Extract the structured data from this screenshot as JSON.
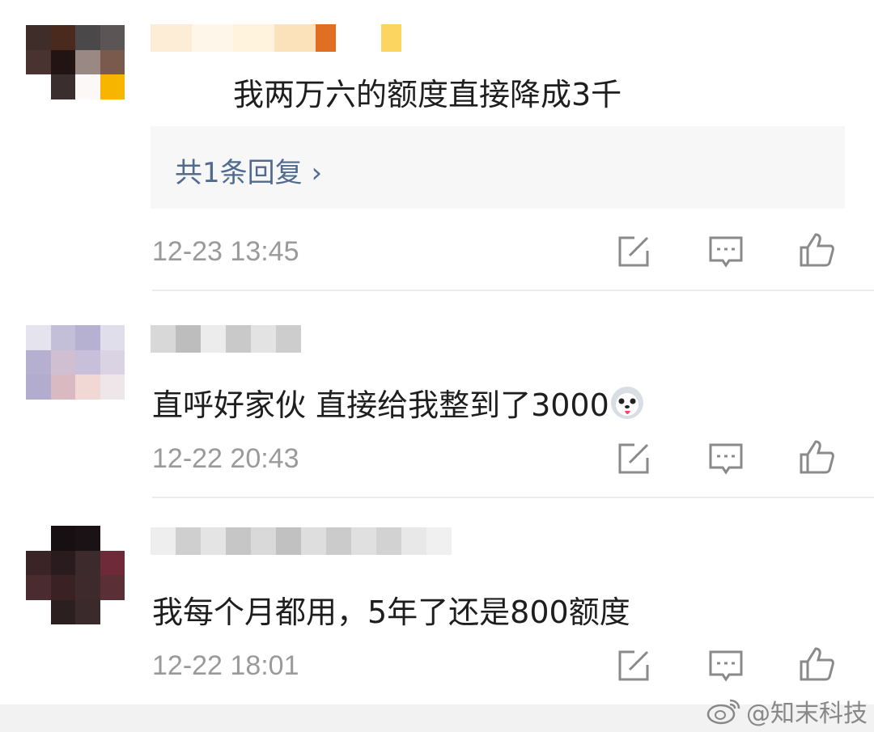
{
  "comments": [
    {
      "text": "我两万六的额度直接降成3千",
      "replies_link": "共1条回复 ›",
      "time": "12-23 13:45"
    },
    {
      "text": "直呼好家伙 直接给我整到了3000",
      "time": "12-22 20:43"
    },
    {
      "text": "我每个月都用，5年了还是800额度",
      "time": "12-22 18:01"
    }
  ],
  "watermark": "@知末科技",
  "icons": {
    "edit": "edit-icon",
    "comment": "comment-icon",
    "like": "thumbs-up-icon",
    "emoji": "husky-emoji-icon",
    "weibo": "weibo-logo-icon"
  },
  "colors": {
    "text": "#1e1e1e",
    "time": "#9a9a9a",
    "link": "#516b8f",
    "reply_bg": "#f7f7f7"
  }
}
